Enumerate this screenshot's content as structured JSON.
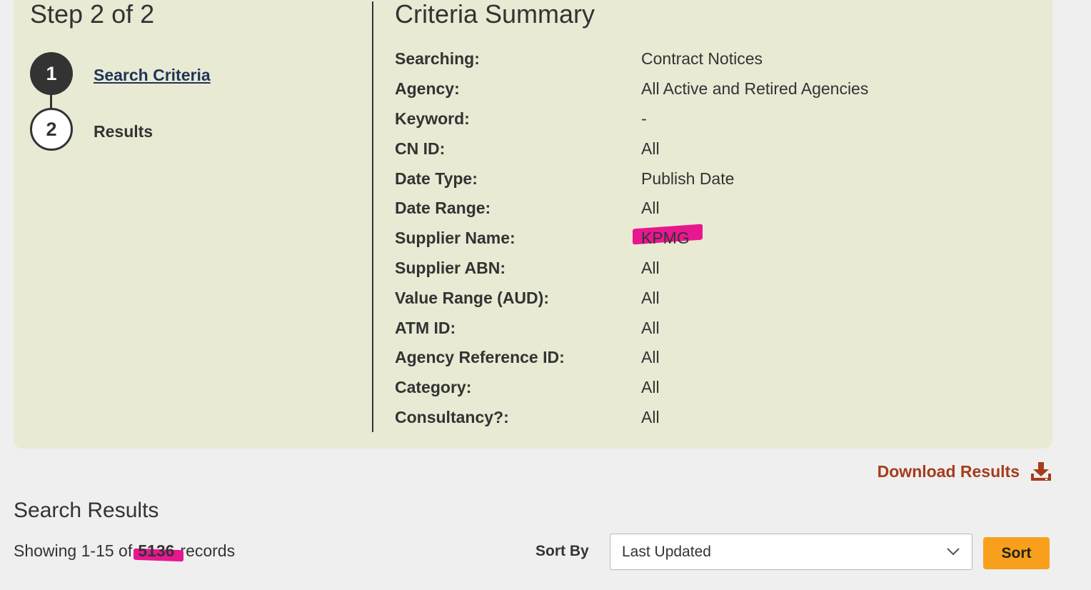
{
  "stepper": {
    "title": "Step 2 of 2",
    "steps": [
      {
        "number": "1",
        "label": "Search Criteria",
        "state": "completed"
      },
      {
        "number": "2",
        "label": "Results",
        "state": "current"
      }
    ]
  },
  "summary": {
    "title": "Criteria Summary",
    "rows": [
      {
        "label": "Searching:",
        "value": "Contract Notices"
      },
      {
        "label": "Agency:",
        "value": "All Active and Retired Agencies"
      },
      {
        "label": "Keyword:",
        "value": "-"
      },
      {
        "label": "CN ID:",
        "value": "All"
      },
      {
        "label": "Date Type:",
        "value": "Publish Date"
      },
      {
        "label": "Date Range:",
        "value": "All"
      },
      {
        "label": "Supplier Name:",
        "value": "KPMG"
      },
      {
        "label": "Supplier ABN:",
        "value": "All"
      },
      {
        "label": "Value Range (AUD):",
        "value": "All"
      },
      {
        "label": "ATM ID:",
        "value": "All"
      },
      {
        "label": "Agency Reference ID:",
        "value": "All"
      },
      {
        "label": "Category:",
        "value": "All"
      },
      {
        "label": "Consultancy?:",
        "value": "All"
      }
    ]
  },
  "download": {
    "label": "Download Results",
    "icon": "download-icon",
    "color": "#a63c1c"
  },
  "results": {
    "title": "Search Results",
    "showing_prefix": "Showing 1-15 of",
    "total": "5136",
    "showing_suffix": "records"
  },
  "sort": {
    "label": "Sort By",
    "selected": "Last Updated",
    "button_label": "Sort",
    "button_color": "#f8a01b"
  },
  "colors": {
    "panel_bg": "#e9ead4",
    "page_bg": "#efefef",
    "highlight": "#e8178f"
  }
}
